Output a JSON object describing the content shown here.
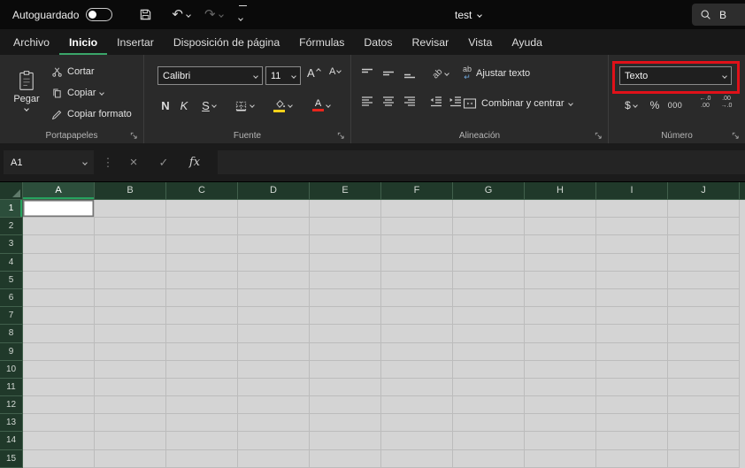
{
  "title_bar": {
    "autosave_label": "Autoguardado",
    "autosave_state": "off",
    "workbook_name": "test",
    "search_text": "B"
  },
  "ribbon_tabs": [
    {
      "label": "Archivo",
      "active": false
    },
    {
      "label": "Inicio",
      "active": true
    },
    {
      "label": "Insertar",
      "active": false
    },
    {
      "label": "Disposición de página",
      "active": false
    },
    {
      "label": "Fórmulas",
      "active": false
    },
    {
      "label": "Datos",
      "active": false
    },
    {
      "label": "Revisar",
      "active": false
    },
    {
      "label": "Vista",
      "active": false
    },
    {
      "label": "Ayuda",
      "active": false
    }
  ],
  "groups": {
    "clipboard": {
      "label": "Portapapeles",
      "paste": "Pegar",
      "cut": "Cortar",
      "copy": "Copiar",
      "format_painter": "Copiar formato"
    },
    "font": {
      "label": "Fuente",
      "font_name": "Calibri",
      "font_size": "11",
      "bold": "N",
      "italic": "K",
      "underline": "S",
      "grow_letter": "A",
      "shrink_letter": "A",
      "font_color_letter": "A"
    },
    "alignment": {
      "label": "Alineación",
      "orientation_letters": "ab",
      "wrap_letters": "ab",
      "wrap_text": "Ajustar texto",
      "merge_center": "Combinar y centrar"
    },
    "number": {
      "label": "Número",
      "format_value": "Texto",
      "currency": "$",
      "percent": "%",
      "thousands": "000",
      "inc_top": "←.0",
      "inc_bottom": ".00",
      "dec_top": ".00",
      "dec_bottom": "→.0"
    }
  },
  "formula_bar": {
    "name_box_value": "A1",
    "cancel_glyph": "×",
    "enter_glyph": "✓",
    "fx_label": "fx"
  },
  "icons": {
    "undo": "↶",
    "redo": "↷",
    "separator_dots": "⋮",
    "wrap_arrow": "↵",
    "search": "magnifier",
    "save": "floppy-disk",
    "paste": "clipboard",
    "cut": "scissors",
    "copy": "two-pages",
    "format_painter": "paint-brush",
    "borders": "cell-borders",
    "fill_color": "paint-bucket",
    "select_all": "corner-triangle"
  },
  "grid": {
    "columns": [
      "A",
      "B",
      "C",
      "D",
      "E",
      "F",
      "G",
      "H",
      "I",
      "J"
    ],
    "rows": [
      "1",
      "2",
      "3",
      "4",
      "5",
      "6",
      "7",
      "8",
      "9",
      "10",
      "11",
      "12",
      "13",
      "14",
      "15"
    ],
    "selected_cell": "A1"
  },
  "colors": {
    "excel_green_accent": "#27a35f",
    "highlight_red": "#e01119",
    "cell_bg": "#d4d4d4",
    "header_bg": "#20392a",
    "fill_color_swatch": "#ffd11a",
    "font_color_swatch": "#e8251c"
  }
}
